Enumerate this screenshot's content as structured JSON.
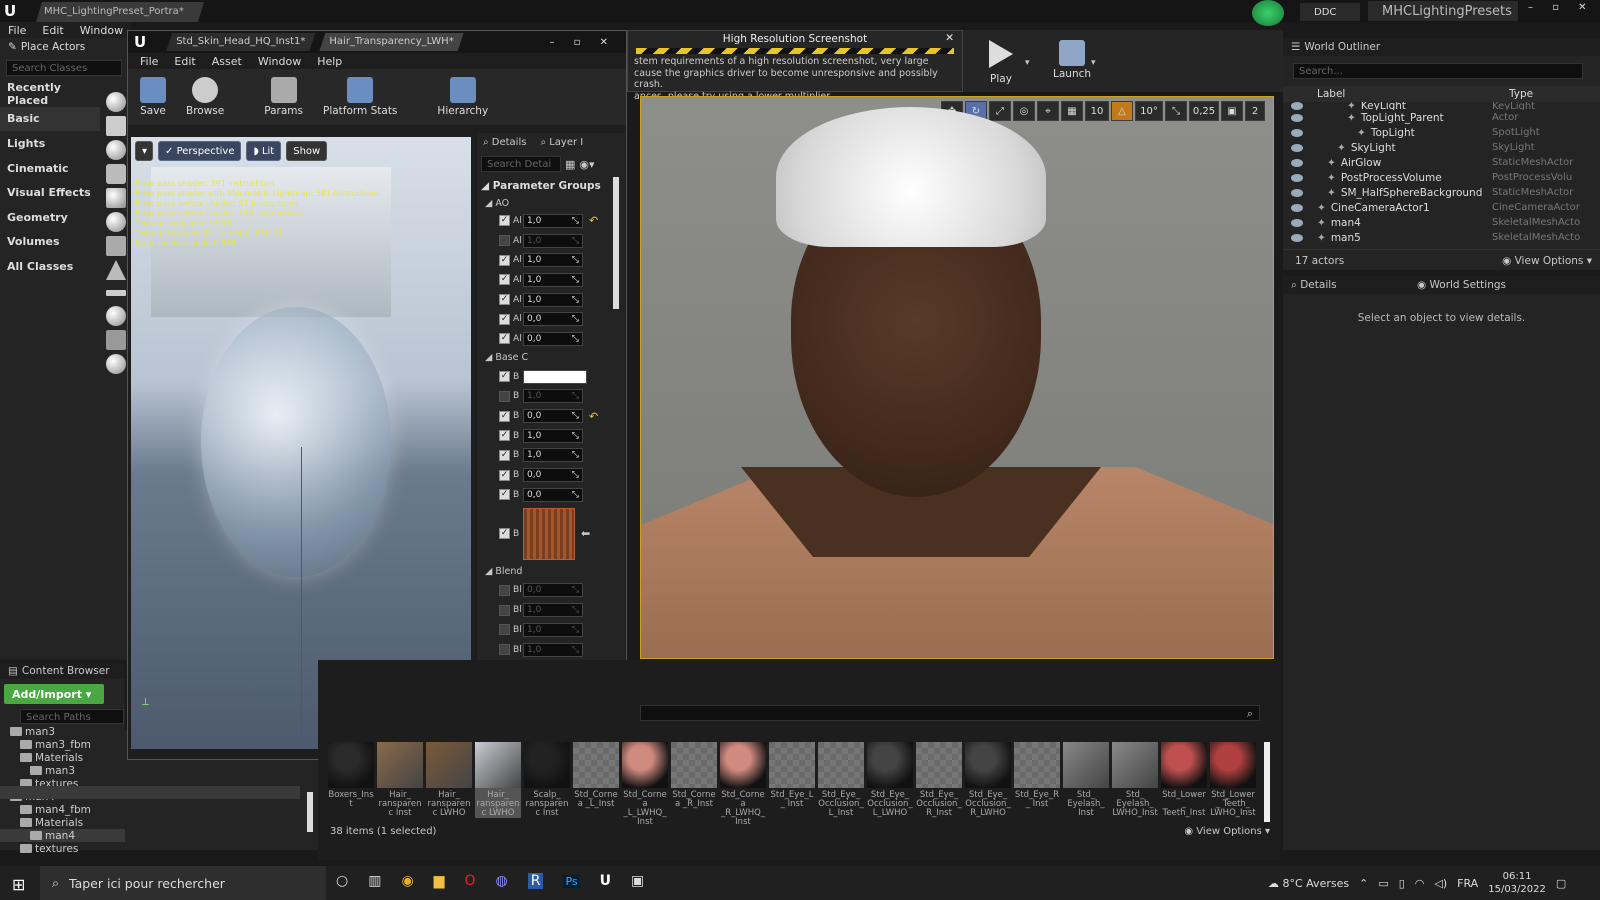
{
  "titlebar": {
    "doc_tab": "MHC_LightingPreset_Portra*",
    "ddc": "DDC",
    "project": "MHCLightingPresets"
  },
  "main_menu": [
    "File",
    "Edit",
    "Window"
  ],
  "place_actors": {
    "title": "Place Actors",
    "search_placeholder": "Search Classes",
    "categories": [
      "Recently Placed",
      "Basic",
      "Lights",
      "Cinematic",
      "Visual Effects",
      "Geometry",
      "Volumes",
      "All Classes"
    ]
  },
  "material_editor": {
    "tabs": [
      "Std_Skin_Head_HQ_Inst1*",
      "Hair_Transparency_LWH*"
    ],
    "menu": [
      "File",
      "Edit",
      "Asset",
      "Window",
      "Help"
    ],
    "toolbar": [
      "Save",
      "Browse",
      "Params",
      "Platform Stats",
      "Hierarchy"
    ],
    "viewport_buttons": {
      "perspective": "Perspective",
      "lit": "Lit",
      "show": "Show"
    },
    "stats": [
      "Base pass shader: 391 instructions",
      "Base pass shader with Volumetric Lightmap: 581 instructions",
      "Base pass vertex shader: 51 instructions",
      "Base pass vertex shader: 160 instructions",
      "Texture samplers: 10/16",
      "Texture Lookups (Est.): VS(0), PS(12)",
      "Num shaders added: 568"
    ],
    "details_tab": "Details",
    "layer_tab": "Layer I",
    "search_placeholder": "Search Detai",
    "param_groups": "Parameter Groups",
    "group_ao": "AO",
    "group_base": "Base C",
    "group_blend": "Blend",
    "ao_rows": [
      {
        "l": "Al",
        "v": "1,0",
        "on": true
      },
      {
        "l": "Al",
        "v": "1,0",
        "on": false
      },
      {
        "l": "Al",
        "v": "1,0",
        "on": true
      },
      {
        "l": "Al",
        "v": "1,0",
        "on": true
      },
      {
        "l": "Al",
        "v": "1,0",
        "on": true
      },
      {
        "l": "Al",
        "v": "0,0",
        "on": true
      },
      {
        "l": "Al",
        "v": "0,0",
        "on": true
      }
    ],
    "base_rows": [
      {
        "l": "B",
        "v": "",
        "on": true
      },
      {
        "l": "B",
        "v": "1,0",
        "on": false
      },
      {
        "l": "B",
        "v": "0,0",
        "on": true
      },
      {
        "l": "B",
        "v": "1,0",
        "on": true
      },
      {
        "l": "B",
        "v": "1,0",
        "on": true
      },
      {
        "l": "B",
        "v": "0,0",
        "on": true
      },
      {
        "l": "B",
        "v": "0,0",
        "on": true
      }
    ],
    "base_tex_label": "B",
    "blend_rows": [
      {
        "l": "Bl",
        "v": "0,0"
      },
      {
        "l": "Bl",
        "v": "1,0"
      },
      {
        "l": "Bl",
        "v": "1,0"
      },
      {
        "l": "Bl",
        "v": "1,0"
      },
      {
        "l": "Bl",
        "v": "1,0"
      },
      {
        "l": "Bl",
        "v": "0,0"
      },
      {
        "l": "Bl",
        "v": "0,0"
      }
    ]
  },
  "hires_dialog": {
    "title": "High Resolution Screenshot",
    "line1": "stem requirements of a high resolution screenshot, very large",
    "line2": "cause the graphics driver to become unresponsive and possibly crash.",
    "line3": "ances, please try using a lower multiplier"
  },
  "main_toolbar": {
    "play": "Play",
    "launch": "Launch"
  },
  "viewport_tools": {
    "grid": "10",
    "rot": "10°",
    "scale": "0,25",
    "cam": "2"
  },
  "world_outliner": {
    "title": "World Outliner",
    "search_placeholder": "Search...",
    "col_label": "Label",
    "col_type": "Type",
    "rows": [
      {
        "label": "KeyLight",
        "type": "KeyLight",
        "indent": 5
      },
      {
        "label": "TopLight_Parent",
        "type": "Actor",
        "indent": 5
      },
      {
        "label": "TopLight",
        "type": "SpotLight",
        "indent": 6
      },
      {
        "label": "SkyLight",
        "type": "SkyLight",
        "indent": 4
      },
      {
        "label": "AirGlow",
        "type": "StaticMeshActor",
        "indent": 3
      },
      {
        "label": "PostProcessVolume",
        "type": "PostProcessVolu",
        "indent": 3
      },
      {
        "label": "SM_HalfSphereBackground",
        "type": "StaticMeshActor",
        "indent": 3
      },
      {
        "label": "CineCameraActor1",
        "type": "CineCameraActor",
        "indent": 2
      },
      {
        "label": "man4",
        "type": "SkeletalMeshActo",
        "indent": 2
      },
      {
        "label": "man5",
        "type": "SkeletalMeshActo",
        "indent": 2
      }
    ],
    "count": "17 actors",
    "view_options": "View Options"
  },
  "details_panel": {
    "tab1": "Details",
    "tab2": "World Settings",
    "empty": "Select an object to view details."
  },
  "content_browser": {
    "title": "Content Browser",
    "add_import": "Add/Import",
    "search_paths": "Search Paths",
    "tree": [
      {
        "t": "man3",
        "d": 1
      },
      {
        "t": "man3_fbm",
        "d": 2
      },
      {
        "t": "Materials",
        "d": 2
      },
      {
        "t": "man3",
        "d": 3
      },
      {
        "t": "textures",
        "d": 2
      },
      {
        "t": "man4",
        "d": 1
      },
      {
        "t": "man4_fbm",
        "d": 2
      },
      {
        "t": "Materials",
        "d": 2
      },
      {
        "t": "man4",
        "d": 3,
        "sel": true
      },
      {
        "t": "textures",
        "d": 2
      }
    ],
    "assets": [
      {
        "l": "Boxers_Inst",
        "c": "#2a2a2a",
        "s": 1
      },
      {
        "l": "Hair_ ransparenc Inst",
        "c": "#8a6a4a",
        "s": 0
      },
      {
        "l": "Hair_ ransparenc LWHO",
        "c": "#7a5a3a",
        "s": 0
      },
      {
        "l": "Hair_ ransparenc LWHO",
        "c": "#c8ccd4",
        "s": 0
      },
      {
        "l": "Scalp_ ransparenc Inst",
        "c": "#222",
        "s": 1
      },
      {
        "l": "Std_Cornea _L_Inst",
        "c": "#777",
        "s": 0
      },
      {
        "l": "Std_Cornea _L_LWHQ_ Inst",
        "c": "#d08a80",
        "s": 1
      },
      {
        "l": "Std_Cornea _R_Inst",
        "c": "#777",
        "s": 0
      },
      {
        "l": "Std_Cornea _R_LWHQ_ Inst",
        "c": "#d08a80",
        "s": 1
      },
      {
        "l": "Std_Eye_L_ Inst",
        "c": "#777",
        "s": 0
      },
      {
        "l": "Std_Eye_ Occlusion_ L_Inst",
        "c": "#777",
        "s": 0
      },
      {
        "l": "Std_Eye_ Occlusion_ L_LWHO",
        "c": "#444",
        "s": 1
      },
      {
        "l": "Std_Eye_ Occlusion_ R_Inst",
        "c": "#777",
        "s": 0
      },
      {
        "l": "Std_Eye_ Occlusion_ R_LWHO",
        "c": "#444",
        "s": 1
      },
      {
        "l": "Std_Eye_R_ Inst",
        "c": "#777",
        "s": 0
      },
      {
        "l": "Std_ Eyelash_ Inst",
        "c": "#888",
        "s": 0
      },
      {
        "l": "Std_ Eyelash_ LWHO_Inst",
        "c": "#888",
        "s": 0
      },
      {
        "l": "Std_Lower_ Teeth_Inst",
        "c": "#c05050",
        "s": 1
      },
      {
        "l": "Std_Lower_ Teeth_ LWHO_Inst",
        "c": "#b04040",
        "s": 1
      }
    ],
    "selection": "38 items (1 selected)",
    "view_options": "View Options"
  },
  "taskbar": {
    "search": "Taper ici pour rechercher",
    "weather": "8°C Averses",
    "lang": "FRA",
    "time": "06:11",
    "date": "15/03/2022"
  }
}
